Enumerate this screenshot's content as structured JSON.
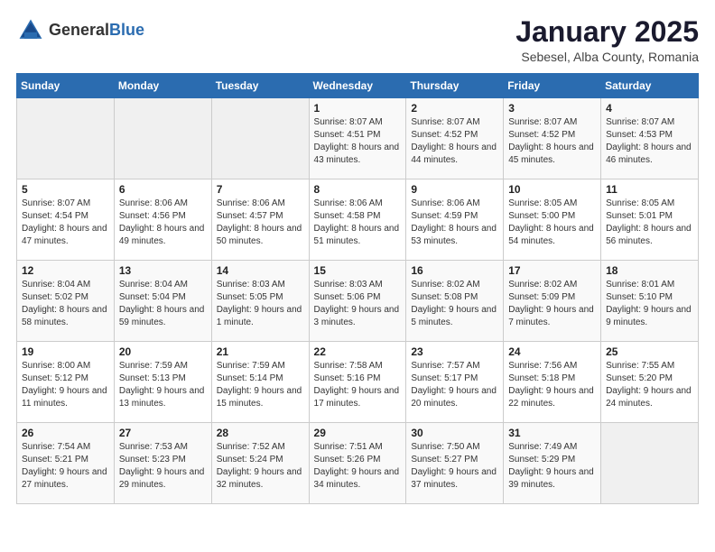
{
  "header": {
    "logo_general": "General",
    "logo_blue": "Blue",
    "month_title": "January 2025",
    "location": "Sebesel, Alba County, Romania"
  },
  "days_of_week": [
    "Sunday",
    "Monday",
    "Tuesday",
    "Wednesday",
    "Thursday",
    "Friday",
    "Saturday"
  ],
  "weeks": [
    [
      {
        "day": "",
        "empty": true
      },
      {
        "day": "",
        "empty": true
      },
      {
        "day": "",
        "empty": true
      },
      {
        "day": "1",
        "sunrise": "8:07 AM",
        "sunset": "4:51 PM",
        "daylight": "8 hours and 43 minutes."
      },
      {
        "day": "2",
        "sunrise": "8:07 AM",
        "sunset": "4:52 PM",
        "daylight": "8 hours and 44 minutes."
      },
      {
        "day": "3",
        "sunrise": "8:07 AM",
        "sunset": "4:52 PM",
        "daylight": "8 hours and 45 minutes."
      },
      {
        "day": "4",
        "sunrise": "8:07 AM",
        "sunset": "4:53 PM",
        "daylight": "8 hours and 46 minutes."
      }
    ],
    [
      {
        "day": "5",
        "sunrise": "8:07 AM",
        "sunset": "4:54 PM",
        "daylight": "8 hours and 47 minutes."
      },
      {
        "day": "6",
        "sunrise": "8:06 AM",
        "sunset": "4:56 PM",
        "daylight": "8 hours and 49 minutes."
      },
      {
        "day": "7",
        "sunrise": "8:06 AM",
        "sunset": "4:57 PM",
        "daylight": "8 hours and 50 minutes."
      },
      {
        "day": "8",
        "sunrise": "8:06 AM",
        "sunset": "4:58 PM",
        "daylight": "8 hours and 51 minutes."
      },
      {
        "day": "9",
        "sunrise": "8:06 AM",
        "sunset": "4:59 PM",
        "daylight": "8 hours and 53 minutes."
      },
      {
        "day": "10",
        "sunrise": "8:05 AM",
        "sunset": "5:00 PM",
        "daylight": "8 hours and 54 minutes."
      },
      {
        "day": "11",
        "sunrise": "8:05 AM",
        "sunset": "5:01 PM",
        "daylight": "8 hours and 56 minutes."
      }
    ],
    [
      {
        "day": "12",
        "sunrise": "8:04 AM",
        "sunset": "5:02 PM",
        "daylight": "8 hours and 58 minutes."
      },
      {
        "day": "13",
        "sunrise": "8:04 AM",
        "sunset": "5:04 PM",
        "daylight": "8 hours and 59 minutes."
      },
      {
        "day": "14",
        "sunrise": "8:03 AM",
        "sunset": "5:05 PM",
        "daylight": "9 hours and 1 minute."
      },
      {
        "day": "15",
        "sunrise": "8:03 AM",
        "sunset": "5:06 PM",
        "daylight": "9 hours and 3 minutes."
      },
      {
        "day": "16",
        "sunrise": "8:02 AM",
        "sunset": "5:08 PM",
        "daylight": "9 hours and 5 minutes."
      },
      {
        "day": "17",
        "sunrise": "8:02 AM",
        "sunset": "5:09 PM",
        "daylight": "9 hours and 7 minutes."
      },
      {
        "day": "18",
        "sunrise": "8:01 AM",
        "sunset": "5:10 PM",
        "daylight": "9 hours and 9 minutes."
      }
    ],
    [
      {
        "day": "19",
        "sunrise": "8:00 AM",
        "sunset": "5:12 PM",
        "daylight": "9 hours and 11 minutes."
      },
      {
        "day": "20",
        "sunrise": "7:59 AM",
        "sunset": "5:13 PM",
        "daylight": "9 hours and 13 minutes."
      },
      {
        "day": "21",
        "sunrise": "7:59 AM",
        "sunset": "5:14 PM",
        "daylight": "9 hours and 15 minutes."
      },
      {
        "day": "22",
        "sunrise": "7:58 AM",
        "sunset": "5:16 PM",
        "daylight": "9 hours and 17 minutes."
      },
      {
        "day": "23",
        "sunrise": "7:57 AM",
        "sunset": "5:17 PM",
        "daylight": "9 hours and 20 minutes."
      },
      {
        "day": "24",
        "sunrise": "7:56 AM",
        "sunset": "5:18 PM",
        "daylight": "9 hours and 22 minutes."
      },
      {
        "day": "25",
        "sunrise": "7:55 AM",
        "sunset": "5:20 PM",
        "daylight": "9 hours and 24 minutes."
      }
    ],
    [
      {
        "day": "26",
        "sunrise": "7:54 AM",
        "sunset": "5:21 PM",
        "daylight": "9 hours and 27 minutes."
      },
      {
        "day": "27",
        "sunrise": "7:53 AM",
        "sunset": "5:23 PM",
        "daylight": "9 hours and 29 minutes."
      },
      {
        "day": "28",
        "sunrise": "7:52 AM",
        "sunset": "5:24 PM",
        "daylight": "9 hours and 32 minutes."
      },
      {
        "day": "29",
        "sunrise": "7:51 AM",
        "sunset": "5:26 PM",
        "daylight": "9 hours and 34 minutes."
      },
      {
        "day": "30",
        "sunrise": "7:50 AM",
        "sunset": "5:27 PM",
        "daylight": "9 hours and 37 minutes."
      },
      {
        "day": "31",
        "sunrise": "7:49 AM",
        "sunset": "5:29 PM",
        "daylight": "9 hours and 39 minutes."
      },
      {
        "day": "",
        "empty": true
      }
    ]
  ]
}
